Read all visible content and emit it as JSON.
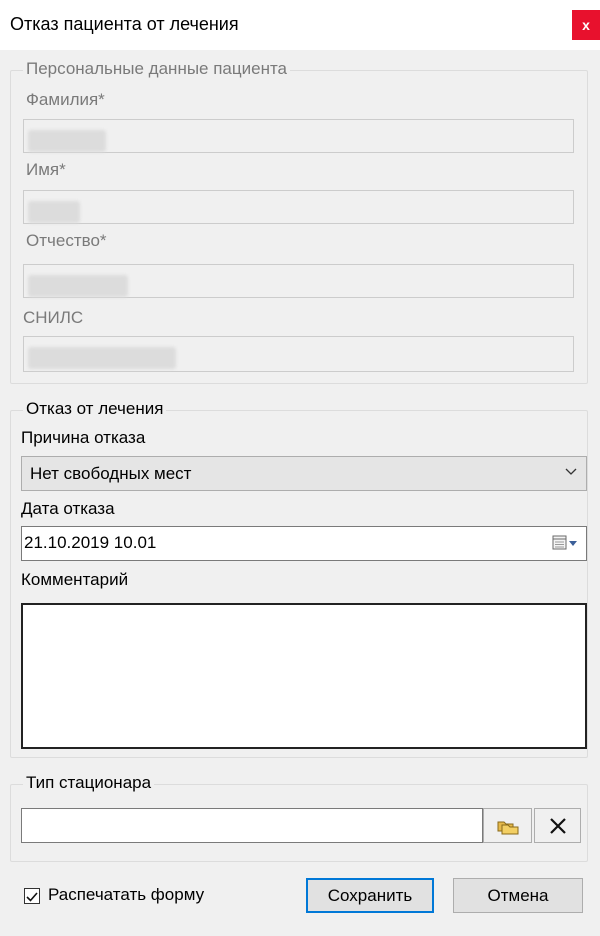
{
  "window": {
    "title": "Отказ пациента от лечения",
    "close_label": "x"
  },
  "personal": {
    "legend": "Персональные данные пациента",
    "surname_label": "Фамилия*",
    "name_label": "Имя*",
    "patronymic_label": "Отчество*",
    "snils_label": "СНИЛС"
  },
  "refusal": {
    "legend": "Отказ от лечения",
    "reason_label": "Причина отказа",
    "reason_value": "Нет свободных мест",
    "date_label": "Дата отказа",
    "date_value": "21.10.2019 10.01",
    "comment_label": "Комментарий",
    "comment_value": ""
  },
  "hospital": {
    "legend": "Тип стационара",
    "value": ""
  },
  "footer": {
    "print_label": "Распечатать форму",
    "print_checked": true,
    "save_label": "Сохранить",
    "cancel_label": "Отмена"
  },
  "colors": {
    "close_bg": "#e8112d",
    "default_button_border": "#0078d7",
    "disabled_text": "#7a7a7a"
  }
}
